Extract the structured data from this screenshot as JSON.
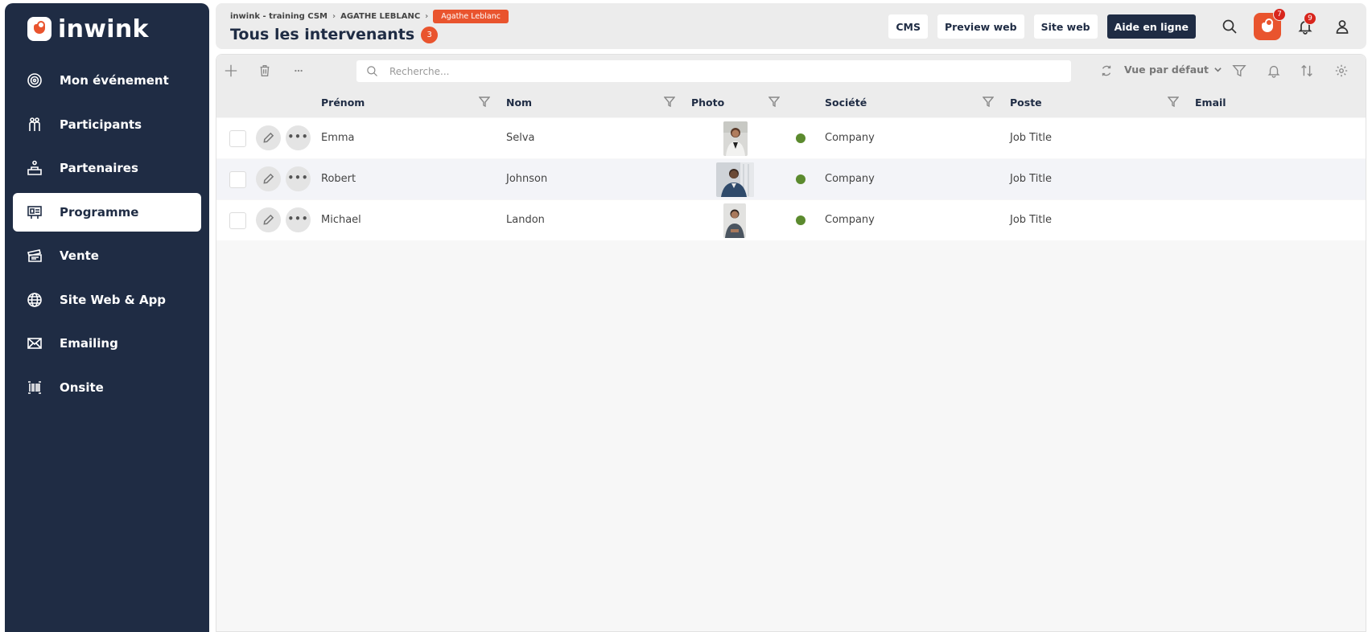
{
  "brand": {
    "name": "inwink",
    "accent": "#e9542e",
    "navy": "#1f2c44",
    "status_green": "#5b8a2e"
  },
  "sidebar": {
    "items": [
      {
        "label": "Mon événement",
        "icon": "target-icon"
      },
      {
        "label": "Participants",
        "icon": "users-icon"
      },
      {
        "label": "Partenaires",
        "icon": "podium-icon"
      },
      {
        "label": "Programme",
        "icon": "presentation-icon",
        "active": true
      },
      {
        "label": "Vente",
        "icon": "ticket-icon"
      },
      {
        "label": "Site Web & App",
        "icon": "globe-icon"
      },
      {
        "label": "Emailing",
        "icon": "mail-icon"
      },
      {
        "label": "Onsite",
        "icon": "barcode-icon"
      }
    ]
  },
  "header": {
    "breadcrumb": [
      "inwink - training CSM",
      "AGATHE LEBLANC"
    ],
    "breadcrumb_badge": "Agathe Leblanc",
    "title": "Tous les intervenants",
    "count": "3",
    "buttons": {
      "cms": "CMS",
      "preview": "Preview web",
      "site": "Site web",
      "help": "Aide en ligne"
    },
    "app_notif_count": "7",
    "bell_notif_count": "9"
  },
  "toolbar": {
    "search_placeholder": "Recherche...",
    "view_label": "Vue par défaut"
  },
  "table": {
    "columns": [
      "Prénom",
      "Nom",
      "Photo",
      "Société",
      "Poste",
      "Email"
    ],
    "rows": [
      {
        "prenom": "Emma",
        "nom": "Selva",
        "societe": "Company",
        "poste": "Job Title",
        "email": ""
      },
      {
        "prenom": "Robert",
        "nom": "Johnson",
        "societe": "Company",
        "poste": "Job Title",
        "email": ""
      },
      {
        "prenom": "Michael",
        "nom": "Landon",
        "societe": "Company",
        "poste": "Job Title",
        "email": ""
      }
    ]
  }
}
